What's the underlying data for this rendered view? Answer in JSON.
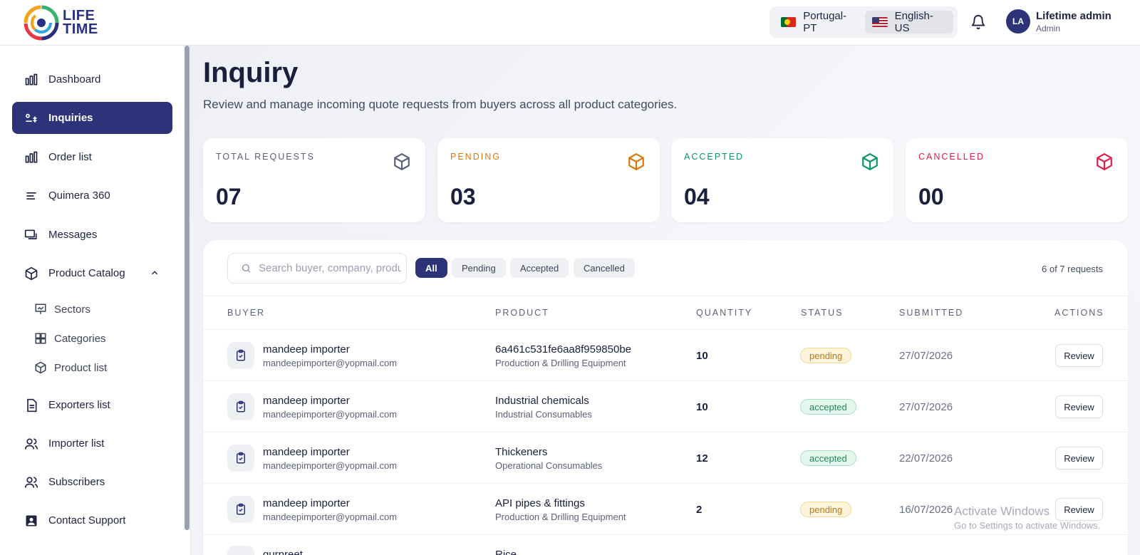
{
  "brand": {
    "logo_line1": "LIFE",
    "logo_line2": "TIME"
  },
  "header": {
    "languages": [
      {
        "label": "Portugal-PT",
        "flag": "portugal-flag-icon",
        "active": false
      },
      {
        "label": "English-US",
        "flag": "us-flag-icon",
        "active": true
      }
    ],
    "user": {
      "initials": "LA",
      "name": "Lifetime admin",
      "role": "Admin"
    }
  },
  "sidebar": {
    "items": [
      {
        "label": "Dashboard",
        "icon": "bar-chart-icon"
      },
      {
        "label": "Inquiries",
        "icon": "inquiries-icon",
        "active": true
      },
      {
        "label": "Order list",
        "icon": "bar-chart-icon"
      },
      {
        "label": "Quimera 360",
        "icon": "lines-icon"
      },
      {
        "label": "Messages",
        "icon": "messages-icon"
      },
      {
        "label": "Product Catalog",
        "icon": "cube-icon",
        "expanded": true
      },
      {
        "label": "Exporters list",
        "icon": "document-icon"
      },
      {
        "label": "Importer list",
        "icon": "user-group-icon"
      },
      {
        "label": "Subscribers",
        "icon": "user-group-icon"
      },
      {
        "label": "Contact Support",
        "icon": "contact-card-icon"
      }
    ],
    "sub_items": [
      {
        "label": "Sectors",
        "icon": "presentation-chart-icon"
      },
      {
        "label": "Categories",
        "icon": "grid-icon"
      },
      {
        "label": "Product list",
        "icon": "cube-icon"
      }
    ]
  },
  "page": {
    "title": "Inquiry",
    "subtitle": "Review and manage incoming quote requests from buyers across all product categories."
  },
  "stats": [
    {
      "label": "TOTAL REQUESTS",
      "value": "07",
      "color": "#5b6076"
    },
    {
      "label": "PENDING",
      "value": "03",
      "color": "#d97706"
    },
    {
      "label": "ACCEPTED",
      "value": "04",
      "color": "#059669"
    },
    {
      "label": "CANCELLED",
      "value": "00",
      "color": "#e11d48"
    }
  ],
  "toolbar": {
    "search_placeholder": "Search buyer, company, product…",
    "filters": [
      "All",
      "Pending",
      "Accepted",
      "Cancelled"
    ],
    "active_filter": "All",
    "count_text": "6 of 7 requests"
  },
  "table": {
    "headers": [
      "BUYER",
      "PRODUCT",
      "QUANTITY",
      "STATUS",
      "SUBMITTED",
      "ACTIONS"
    ],
    "rows": [
      {
        "buyer": "mandeep importer",
        "email": "mandeepimporter@yopmail.com",
        "product": "6a461c531fe6aa8f959850be",
        "category": "Production & Drilling Equipment",
        "quantity": "10",
        "status": "pending",
        "submitted": "27/07/2026",
        "action": "Review"
      },
      {
        "buyer": "mandeep importer",
        "email": "mandeepimporter@yopmail.com",
        "product": "Industrial chemicals",
        "category": "Industrial Consumables",
        "quantity": "10",
        "status": "accepted",
        "submitted": "27/07/2026",
        "action": "Review"
      },
      {
        "buyer": "mandeep importer",
        "email": "mandeepimporter@yopmail.com",
        "product": "Thickeners",
        "category": "Operational Consumables",
        "quantity": "12",
        "status": "accepted",
        "submitted": "22/07/2026",
        "action": "Review"
      },
      {
        "buyer": "mandeep importer",
        "email": "mandeepimporter@yopmail.com",
        "product": "API pipes & fittings",
        "category": "Production & Drilling Equipment",
        "quantity": "2",
        "status": "pending",
        "submitted": "16/07/2026",
        "action": "Review"
      },
      {
        "buyer": "gurpreet",
        "product": "Rice"
      }
    ]
  },
  "overlay": {
    "watermark_title": "Activate Windows",
    "watermark_sub": "Go to Settings to activate Windows."
  }
}
